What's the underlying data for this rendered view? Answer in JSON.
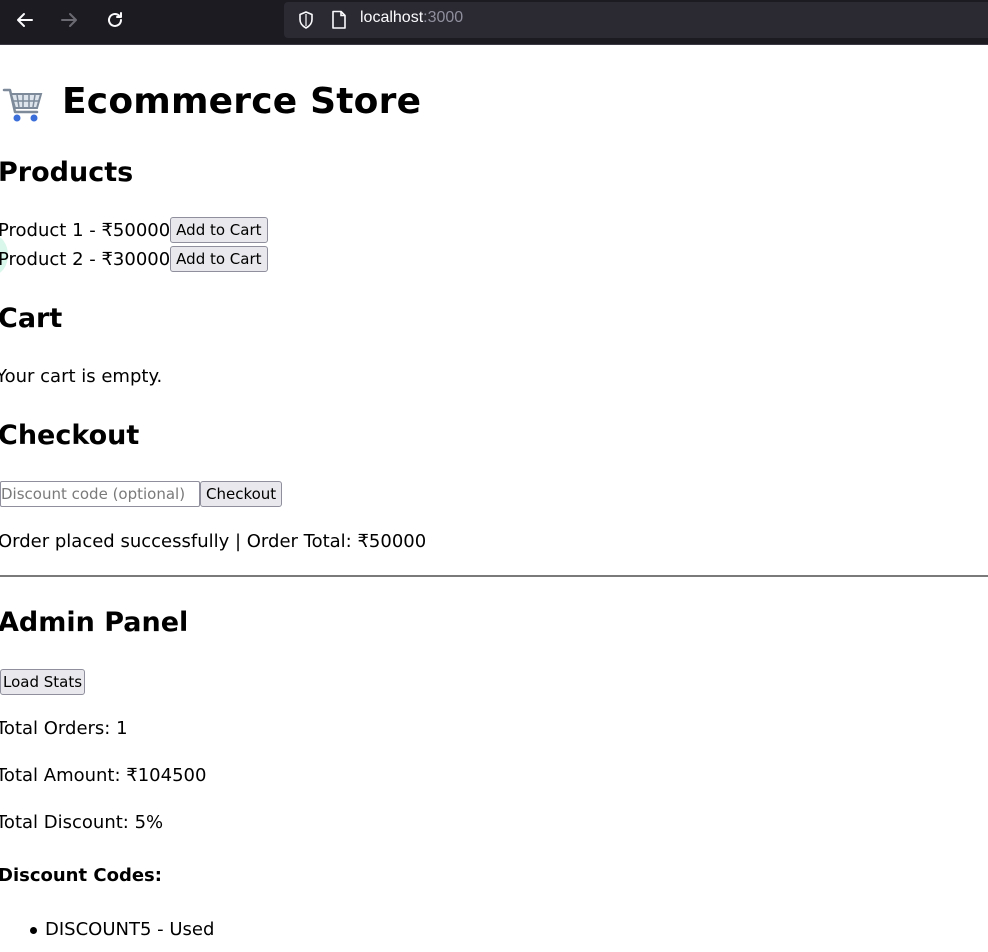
{
  "browser": {
    "url_host": "localhost",
    "url_port": ":3000"
  },
  "page": {
    "title": "Ecommerce Store",
    "products_heading": "Products",
    "products": [
      {
        "label": "Product 1 - ₹50000",
        "button": "Add to Cart"
      },
      {
        "label": "Product 2 - ₹30000",
        "button": "Add to Cart"
      }
    ],
    "cart_heading": "Cart",
    "cart_empty": "Your cart is empty.",
    "checkout_heading": "Checkout",
    "discount_placeholder": "Discount code (optional)",
    "checkout_button": "Checkout",
    "order_message": "Order placed successfully | Order Total: ₹50000",
    "admin_heading": "Admin Panel",
    "load_stats_button": "Load Stats",
    "total_orders": "Total Orders: 1",
    "total_amount": "Total Amount: ₹104500",
    "total_discount": "Total Discount: 5%",
    "discount_codes_heading": "Discount Codes:",
    "discount_codes": [
      "DISCOUNT5 - Used"
    ]
  }
}
